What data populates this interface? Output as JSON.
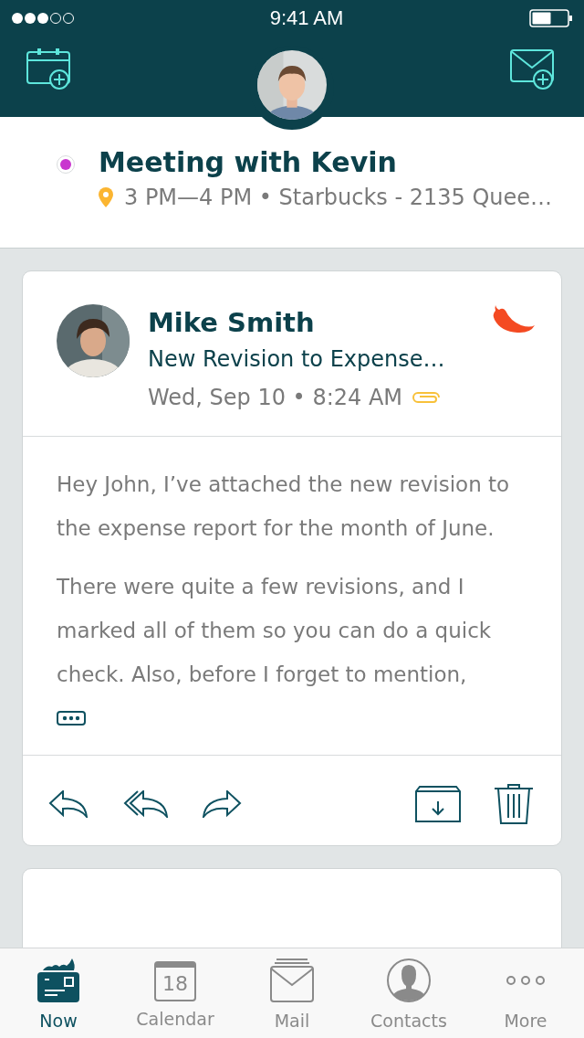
{
  "status_bar": {
    "time": "9:41 AM"
  },
  "event": {
    "color": "#c935cf",
    "title": "Meeting with Kevin",
    "details": "3 PM—4 PM • Starbucks - 2135 Quee…"
  },
  "emails": [
    {
      "sender": "Mike Smith",
      "subject": "New Revision to Expense…",
      "date": "Wed, Sep 10 • 8:24 AM",
      "attachment": true,
      "priority": true,
      "body": [
        "Hey John, I’ve attached the new revision to the expense report for the month of June.",
        "There were quite a few revisions, and I marked all of them so you can do a quick check. Also, before I forget to mention,"
      ],
      "truncated": true
    }
  ],
  "tabs": [
    {
      "kind": "now",
      "label": "Now",
      "selected": true
    },
    {
      "kind": "calendar",
      "label": "Calendar",
      "day": "18",
      "selected": false
    },
    {
      "kind": "mail",
      "label": "Mail",
      "selected": false
    },
    {
      "kind": "contacts",
      "label": "Contacts",
      "selected": false
    },
    {
      "kind": "more",
      "label": "More",
      "selected": false
    }
  ]
}
